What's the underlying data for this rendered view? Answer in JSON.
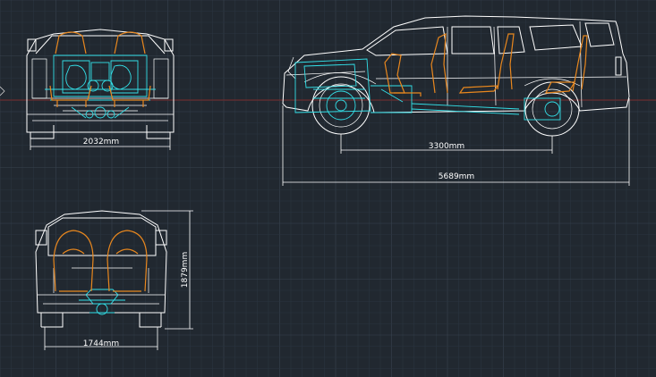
{
  "colors": {
    "background": "#212830",
    "grid_minor": "#2b3440",
    "grid_major": "#38424f",
    "axis_red": "#7a2a2a",
    "body_lines": "#ffffff",
    "mechanical": "#33e0e8",
    "seats": "#e8871e"
  },
  "dimensions": {
    "front_width": "2032mm",
    "wheelbase": "3300mm",
    "overall_length": "5689mm",
    "rear_width": "1744mm",
    "height": "1879mm"
  }
}
